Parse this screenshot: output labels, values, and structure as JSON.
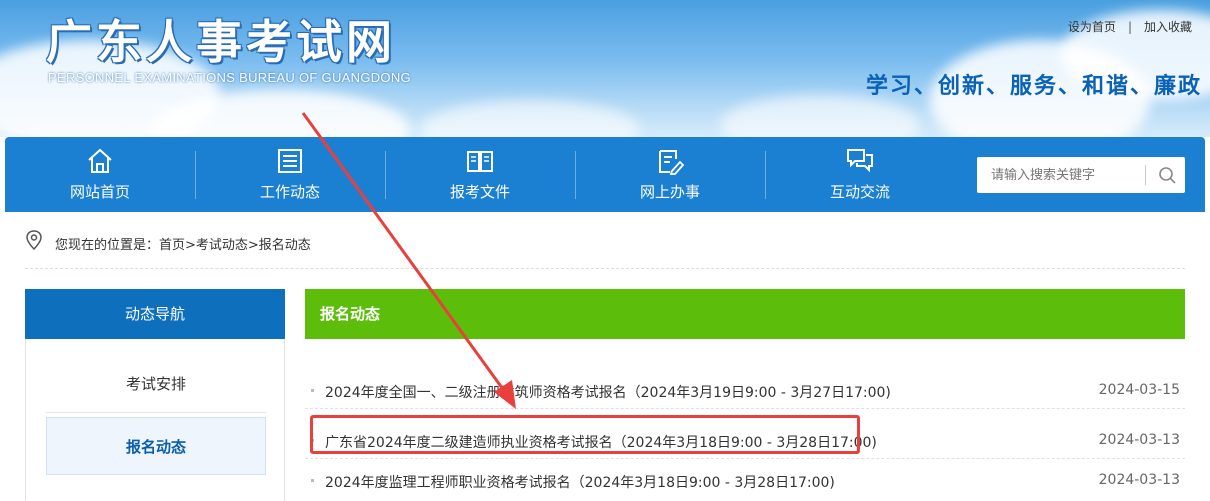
{
  "header": {
    "logo_cn": "广东人事考试网",
    "logo_en": "PERSONNEL EXAMINATIONS BUREAU OF GUANGDONG",
    "links": [
      "设为首页",
      "|",
      "加入收藏"
    ],
    "slogan": "学习、创新、服务、和谐、廉政"
  },
  "nav": {
    "items": [
      {
        "label": "网站首页",
        "icon": "home-icon"
      },
      {
        "label": "工作动态",
        "icon": "news-icon"
      },
      {
        "label": "报考文件",
        "icon": "book-icon"
      },
      {
        "label": "网上办事",
        "icon": "form-edit-icon"
      },
      {
        "label": "互动交流",
        "icon": "chat-icon"
      }
    ],
    "search_placeholder": "请输入搜索关键字"
  },
  "breadcrumb": {
    "text": "您现在的位置是：首页>考试动态>报名动态"
  },
  "sidebar": {
    "title": "动态导航",
    "items": [
      {
        "label": "考试安排",
        "active": false
      },
      {
        "label": "报名动态",
        "active": true
      }
    ]
  },
  "main": {
    "title": "报名动态",
    "rows": [
      {
        "title": "2024年度全国一、二级注册建筑师资格考试报名（2024年3月19日9:00 - 3月27日17:00)",
        "date": "2024-03-15"
      },
      {
        "title": "广东省2024年度二级建造师执业资格考试报名（2024年3月18日9:00 - 3月28日17:00)",
        "date": "2024-03-13"
      },
      {
        "title": "2024年度监理工程师职业资格考试报名（2024年3月18日9:00 - 3月28日17:00)",
        "date": "2024-03-13"
      }
    ]
  },
  "colors": {
    "nav_blue": "#1c80d2",
    "sidebar_blue": "#0e6fbd",
    "main_green": "#5cbd0b",
    "highlight_red": "#e8403c"
  }
}
